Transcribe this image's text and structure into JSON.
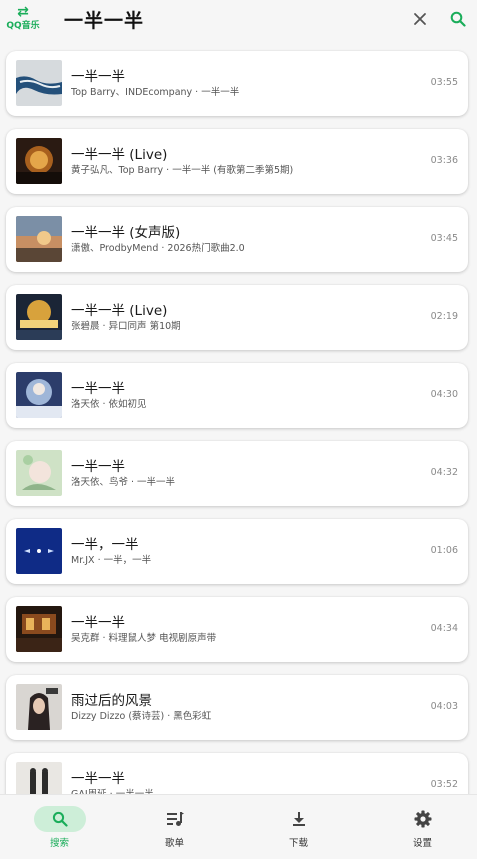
{
  "header": {
    "source_label": "QQ音乐",
    "source_icon": "swap-arrows-icon",
    "query": "一半一半",
    "clear_icon": "close-icon",
    "search_icon": "search-icon",
    "accent": "#1aad5a"
  },
  "songs": [
    {
      "title": "一半一半",
      "subtitle": "Top Barry、INDEcompany · 一半一半",
      "duration": "03:55"
    },
    {
      "title": "一半一半 (Live)",
      "subtitle": "黄子弘凡、Top Barry · 一半一半 (有歌第二季第5期)",
      "duration": "03:36"
    },
    {
      "title": "一半一半 (女声版)",
      "subtitle": "潇傲、ProdbyMend · 2026热门歌曲2.0",
      "duration": "03:45"
    },
    {
      "title": "一半一半 (Live)",
      "subtitle": "张碧晨 · 异口同声 第10期",
      "duration": "02:19"
    },
    {
      "title": "一半一半",
      "subtitle": "洛天依 · 依如初见",
      "duration": "04:30"
    },
    {
      "title": "一半一半",
      "subtitle": "洛天依、鸟爷 · 一半一半",
      "duration": "04:32"
    },
    {
      "title": "一半，一半",
      "subtitle": "Mr.JX · 一半，一半",
      "duration": "01:06"
    },
    {
      "title": "一半一半",
      "subtitle": "吴克群 · 料理鼠人梦 电视剧原声带",
      "duration": "04:34"
    },
    {
      "title": "雨过后的风景",
      "subtitle": "Dizzy Dizzo (蔡诗芸) · 黑色彩虹",
      "duration": "04:03"
    },
    {
      "title": "一半一半",
      "subtitle": "GAI周延 · 一半一半",
      "duration": "03:52"
    }
  ],
  "nav": [
    {
      "label": "搜索",
      "icon": "search-icon",
      "active": true
    },
    {
      "label": "歌单",
      "icon": "playlist-icon",
      "active": false
    },
    {
      "label": "下载",
      "icon": "download-icon",
      "active": false
    },
    {
      "label": "设置",
      "icon": "gear-icon",
      "active": false
    }
  ]
}
